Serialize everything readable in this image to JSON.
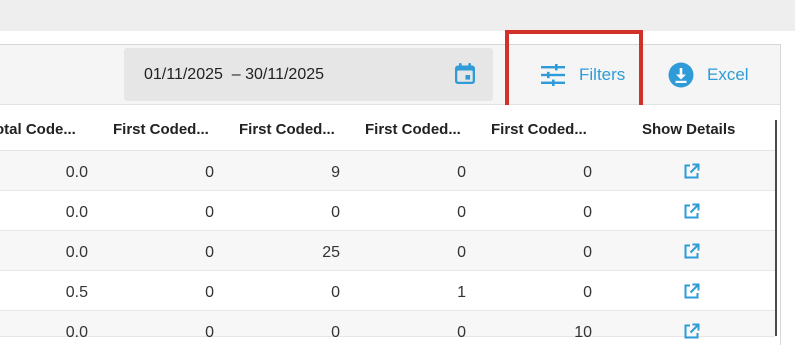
{
  "toolbar": {
    "date_range": "01/11/2025  – 30/11/2025",
    "filters_label": "Filters",
    "excel_label": "Excel",
    "accent": "#2f9bd8",
    "highlight_color": "#d2302a"
  },
  "table": {
    "columns": [
      "otal Code...",
      "First Coded...",
      "First Coded...",
      "First Coded...",
      "First Coded...",
      "Show Details"
    ],
    "rows": [
      [
        "0.0",
        "0",
        "9",
        "0",
        "0"
      ],
      [
        "0.0",
        "0",
        "0",
        "0",
        "0"
      ],
      [
        "0.0",
        "0",
        "25",
        "0",
        "0"
      ],
      [
        "0.5",
        "0",
        "0",
        "1",
        "0"
      ],
      [
        "0.0",
        "0",
        "0",
        "0",
        "10"
      ]
    ]
  },
  "icons": {
    "calendar": "calendar-icon",
    "filters": "sliders-icon",
    "excel": "download-icon",
    "details": "external-link-icon"
  }
}
